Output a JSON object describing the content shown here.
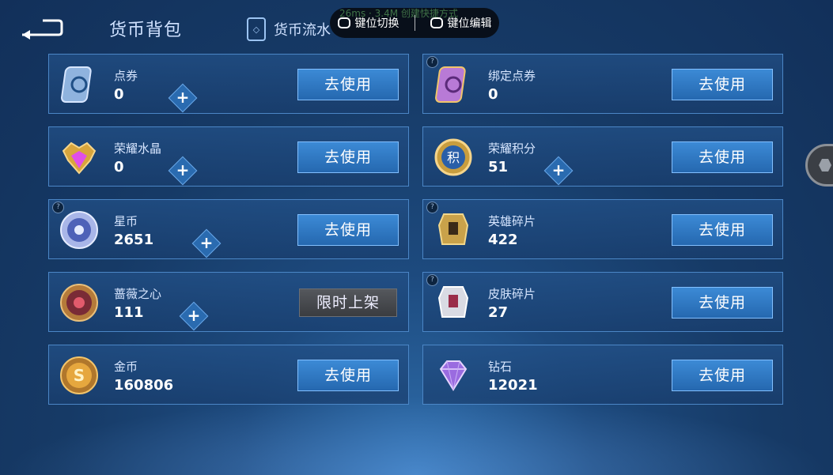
{
  "header": {
    "title": "货币背包",
    "tab_flow": "货币流水"
  },
  "overlay": {
    "ghost_text": "26ms · 3.4M  创建快捷方式",
    "key_switch": "键位切换",
    "key_edit": "键位编辑"
  },
  "use_label": "去使用",
  "limited_label": "限时上架",
  "help_label": "?",
  "plus_label": "+",
  "cards": [
    {
      "name": "点券",
      "value": "0",
      "plus": true,
      "button": "use",
      "help": false,
      "icon": "voucher-icon"
    },
    {
      "name": "绑定点券",
      "value": "0",
      "plus": false,
      "button": "use",
      "help": true,
      "icon": "bound-voucher-icon"
    },
    {
      "name": "荣耀水晶",
      "value": "0",
      "plus": true,
      "button": "use",
      "help": false,
      "icon": "glory-crystal-icon"
    },
    {
      "name": "荣耀积分",
      "value": "51",
      "plus": true,
      "button": "use",
      "help": false,
      "icon": "glory-points-icon"
    },
    {
      "name": "星币",
      "value": "2651",
      "plus": true,
      "button": "use",
      "help": true,
      "icon": "star-coin-icon"
    },
    {
      "name": "英雄碎片",
      "value": "422",
      "plus": false,
      "button": "use",
      "help": true,
      "icon": "hero-fragment-icon"
    },
    {
      "name": "蔷薇之心",
      "value": "111",
      "plus": true,
      "button": "limited",
      "help": false,
      "icon": "rose-heart-icon"
    },
    {
      "name": "皮肤碎片",
      "value": "27",
      "plus": false,
      "button": "use",
      "help": true,
      "icon": "skin-fragment-icon"
    },
    {
      "name": "金币",
      "value": "160806",
      "plus": false,
      "button": "use",
      "help": false,
      "icon": "gold-coin-icon"
    },
    {
      "name": "钻石",
      "value": "12021",
      "plus": false,
      "button": "use",
      "help": false,
      "icon": "diamond-icon"
    }
  ],
  "colors": {
    "accent": "#3c8ad6",
    "card_border": "#4b86c6",
    "background": "#163a66"
  }
}
